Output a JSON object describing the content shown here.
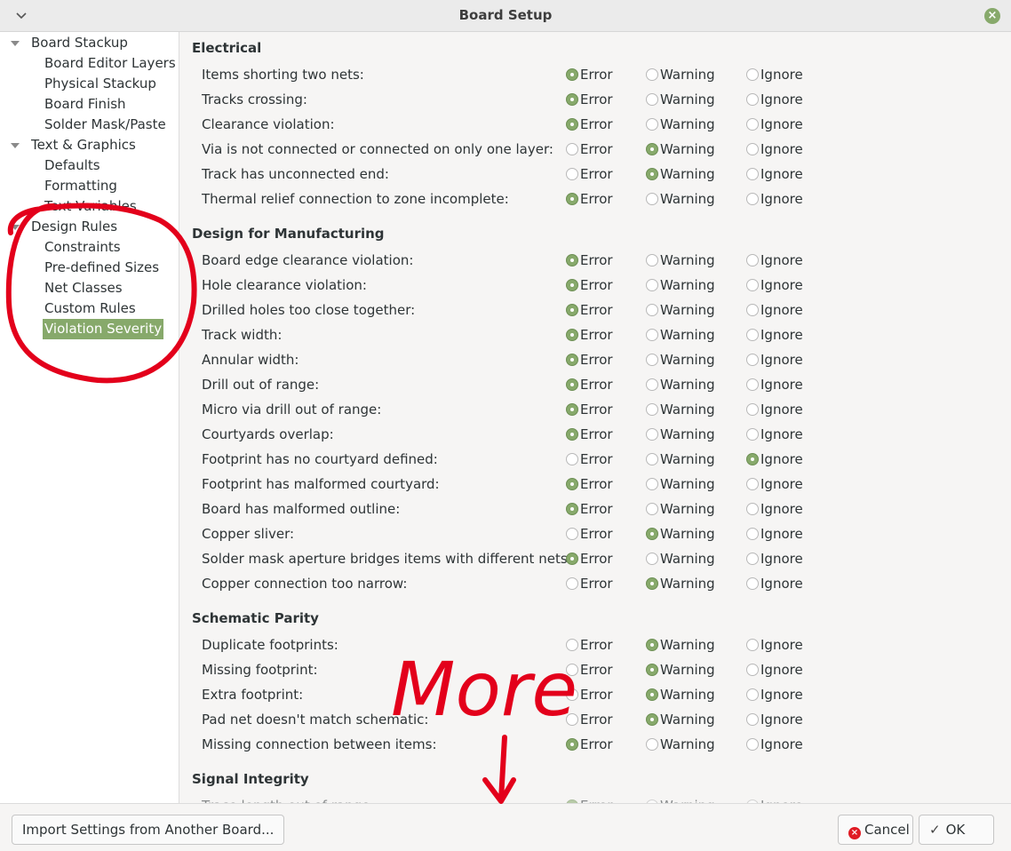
{
  "window": {
    "title": "Board Setup"
  },
  "tree": [
    {
      "label": "Board Stackup",
      "level": 0,
      "expanded": true
    },
    {
      "label": "Board Editor Layers",
      "level": 1
    },
    {
      "label": "Physical Stackup",
      "level": 1
    },
    {
      "label": "Board Finish",
      "level": 1
    },
    {
      "label": "Solder Mask/Paste",
      "level": 1
    },
    {
      "label": "Text & Graphics",
      "level": 0,
      "expanded": true
    },
    {
      "label": "Defaults",
      "level": 1
    },
    {
      "label": "Formatting",
      "level": 1
    },
    {
      "label": "Text Variables",
      "level": 1
    },
    {
      "label": "Design Rules",
      "level": 0,
      "expanded": true
    },
    {
      "label": "Constraints",
      "level": 1
    },
    {
      "label": "Pre-defined Sizes",
      "level": 1
    },
    {
      "label": "Net Classes",
      "level": 1
    },
    {
      "label": "Custom Rules",
      "level": 1
    },
    {
      "label": "Violation Severity",
      "level": 1,
      "selected": true
    }
  ],
  "options": {
    "error": "Error",
    "warning": "Warning",
    "ignore": "Ignore"
  },
  "sections": [
    {
      "title": "Electrical",
      "rules": [
        {
          "label": "Items shorting two nets:",
          "severity": "error"
        },
        {
          "label": "Tracks crossing:",
          "severity": "error"
        },
        {
          "label": "Clearance violation:",
          "severity": "error"
        },
        {
          "label": "Via is not connected or connected on only one layer:",
          "severity": "warning"
        },
        {
          "label": "Track has unconnected end:",
          "severity": "warning"
        },
        {
          "label": "Thermal relief connection to zone incomplete:",
          "severity": "error"
        }
      ]
    },
    {
      "title": "Design for Manufacturing",
      "rules": [
        {
          "label": "Board edge clearance violation:",
          "severity": "error"
        },
        {
          "label": "Hole clearance violation:",
          "severity": "error"
        },
        {
          "label": "Drilled holes too close together:",
          "severity": "error"
        },
        {
          "label": "Track width:",
          "severity": "error"
        },
        {
          "label": "Annular width:",
          "severity": "error"
        },
        {
          "label": "Drill out of range:",
          "severity": "error"
        },
        {
          "label": "Micro via drill out of range:",
          "severity": "error"
        },
        {
          "label": "Courtyards overlap:",
          "severity": "error"
        },
        {
          "label": "Footprint has no courtyard defined:",
          "severity": "ignore"
        },
        {
          "label": "Footprint has malformed courtyard:",
          "severity": "error"
        },
        {
          "label": "Board has malformed outline:",
          "severity": "error"
        },
        {
          "label": "Copper sliver:",
          "severity": "warning"
        },
        {
          "label": "Solder mask aperture bridges items with different nets:",
          "severity": "error"
        },
        {
          "label": "Copper connection too narrow:",
          "severity": "warning"
        }
      ]
    },
    {
      "title": "Schematic Parity",
      "rules": [
        {
          "label": "Duplicate footprints:",
          "severity": "warning"
        },
        {
          "label": "Missing footprint:",
          "severity": "warning"
        },
        {
          "label": "Extra footprint:",
          "severity": "warning"
        },
        {
          "label": "Pad net doesn't match schematic:",
          "severity": "warning"
        },
        {
          "label": "Missing connection between items:",
          "severity": "error"
        }
      ]
    },
    {
      "title": "Signal Integrity",
      "rules": [
        {
          "label": "Trace length out of range:",
          "severity": "error"
        }
      ]
    }
  ],
  "buttons": {
    "import": "Import Settings from Another Board...",
    "cancel": "Cancel",
    "ok": "OK"
  },
  "annotation": {
    "text": "More",
    "color": "#e3001b"
  }
}
